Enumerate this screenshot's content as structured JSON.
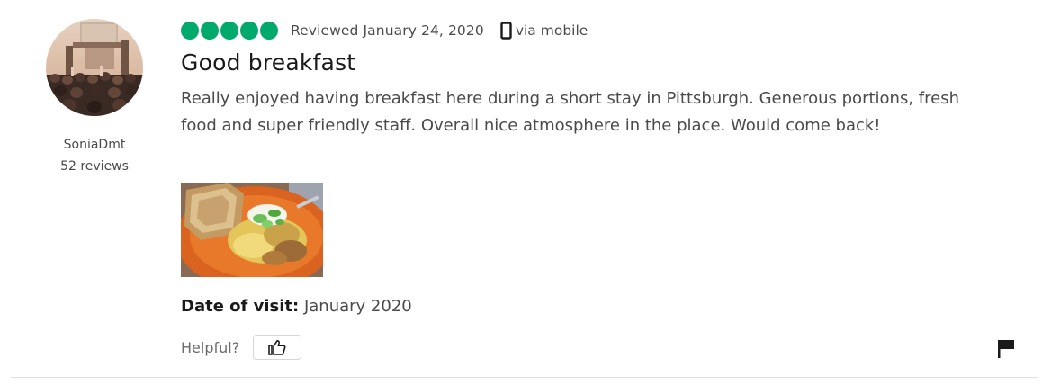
{
  "reviewer": {
    "name": "SoniaDmt",
    "review_count": "52 reviews"
  },
  "rating": {
    "bubbles_filled": 5,
    "bubbles_total": 5,
    "color": "#00aa6c"
  },
  "meta": {
    "date_text": "Reviewed January 24, 2020",
    "device_icon": "mobile-phone-icon",
    "via_text": "via mobile"
  },
  "review": {
    "title": "Good breakfast",
    "body": "Really enjoyed having breakfast here during a short stay in Pittsburgh. Generous portions, fresh food and super friendly staff. Overall nice atmosphere in the place. Would come back!"
  },
  "visit": {
    "label": "Date of visit:",
    "value": "January 2020"
  },
  "helpful": {
    "label": "Helpful?",
    "button_icon": "thumbs-up-icon"
  },
  "actions": {
    "report_icon": "flag-icon"
  }
}
